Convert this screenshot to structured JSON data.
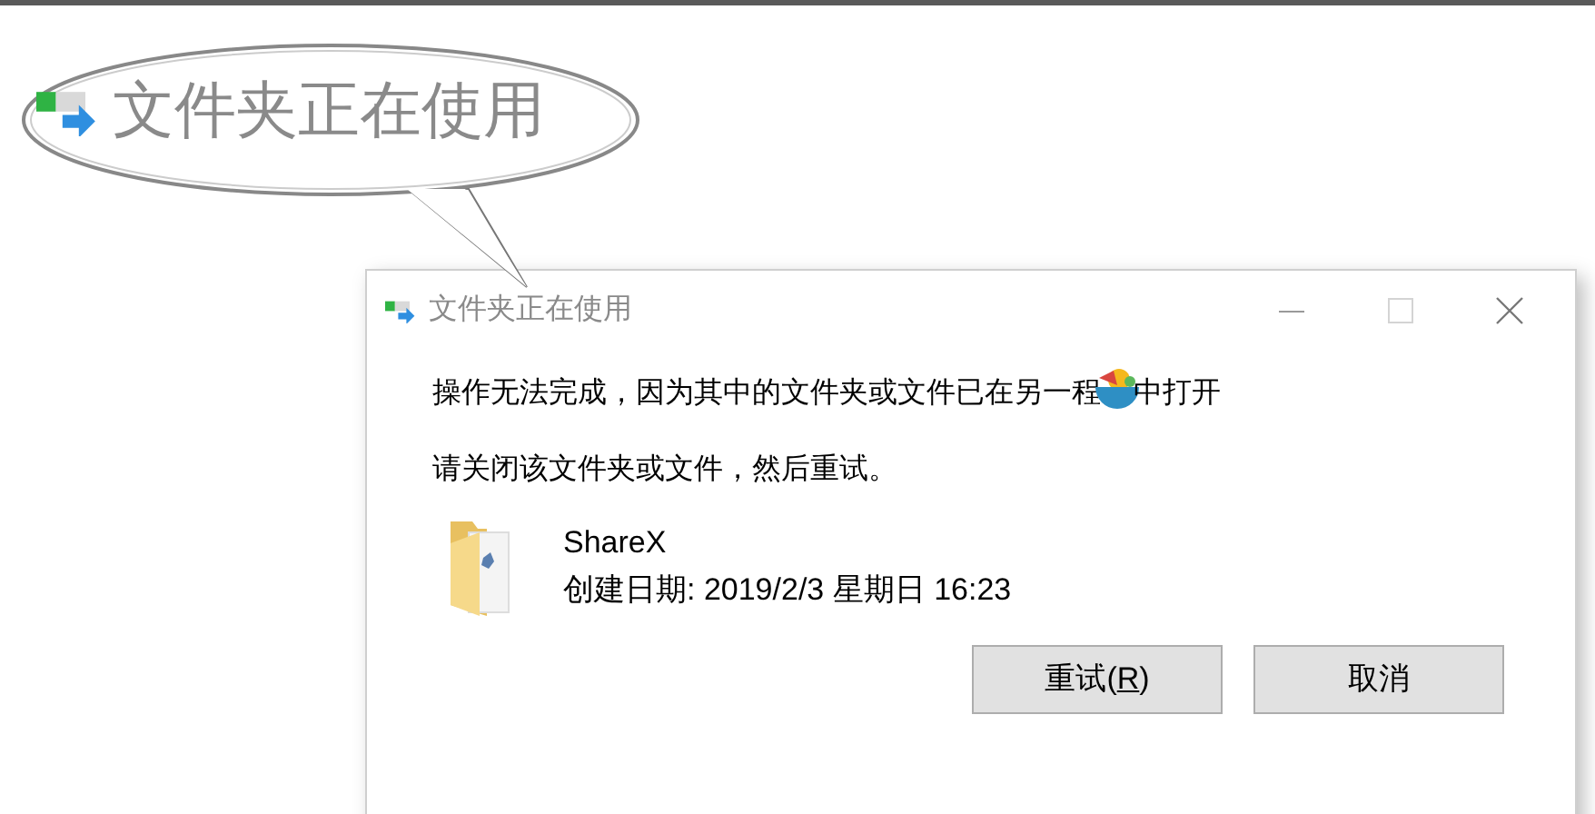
{
  "callout": {
    "title": "文件夹正在使用"
  },
  "window": {
    "title": "文件夹正在使用",
    "active": false
  },
  "message": {
    "before_overlay": "操作无法完成，因为其中的文件夹或文件已在另一程",
    "after_overlay": "中打开",
    "hint": "请关闭该文件夹或文件，然后重试。"
  },
  "item": {
    "name": "ShareX",
    "created": "创建日期: 2019/2/3 星期日 16:23"
  },
  "buttons": [
    {
      "before": "重试(",
      "accelerator": "R",
      "after": ")"
    },
    {
      "before": "取消"
    }
  ]
}
